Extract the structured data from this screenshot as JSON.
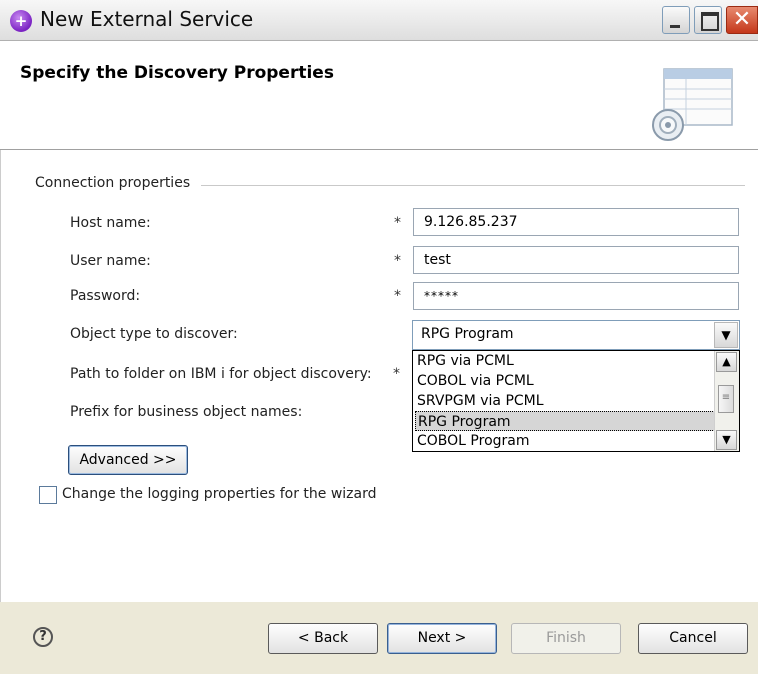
{
  "window": {
    "title": "New External Service"
  },
  "banner": {
    "title": "Specify the Discovery Properties"
  },
  "connection": {
    "group_label": "Connection properties",
    "fields": [
      {
        "label": "Host name:",
        "required": "*",
        "value": "9.126.85.237"
      },
      {
        "label": "User name:",
        "required": "*",
        "value": "test"
      },
      {
        "label": "Password:",
        "required": "*",
        "value": "*****"
      },
      {
        "label": "Object type to discover:",
        "value": "RPG Program"
      },
      {
        "label": "Path to folder on IBM i for object discovery:",
        "required": "*"
      },
      {
        "label": "Prefix for business object names:"
      }
    ],
    "object_type_options": [
      "RPG via PCML",
      "COBOL via PCML",
      "SRVPGM via PCML",
      "RPG Program",
      "COBOL Program"
    ],
    "selected_option": "RPG Program"
  },
  "buttons": {
    "advanced": "Advanced >>",
    "back": "< Back",
    "next": "Next >",
    "finish": "Finish",
    "cancel": "Cancel"
  },
  "logging": {
    "label": "Change the logging properties for the wizard",
    "checked": false
  },
  "icons": {
    "app": "wizard-app-icon",
    "help": "help-icon",
    "banner": "discovery-banner-icon"
  }
}
